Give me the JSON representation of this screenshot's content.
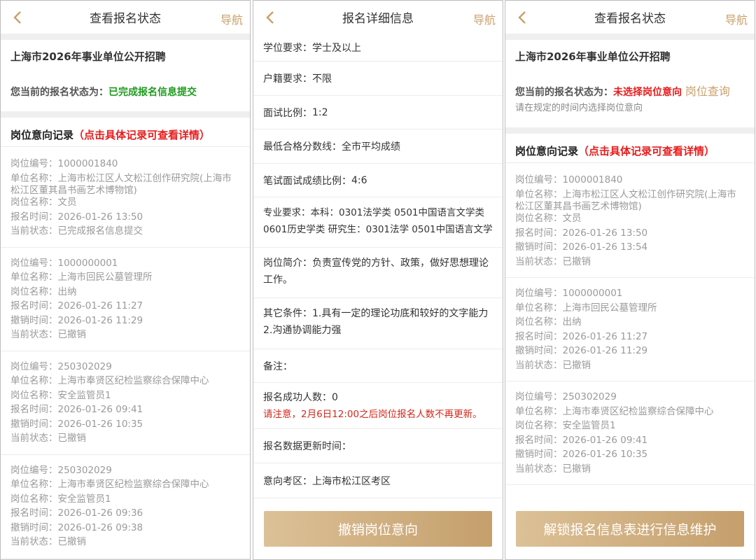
{
  "panel1": {
    "header": {
      "title": "查看报名状态",
      "nav": "导航"
    },
    "project_name": "上海市2026年事业单位公开招聘",
    "status_label": "您当前的报名状态为：",
    "status_value": "已完成报名信息提交",
    "records_title": "岗位意向记录",
    "records_hint": "（点击具体记录可查看详情）",
    "records": [
      {
        "lines": [
          "岗位编号：1000001840",
          "单位名称：上海市松江区人文松江创作研究院(上海市",
          "松江区董其昌书画艺术博物馆)",
          "岗位名称：文员",
          "报名时间：2026-01-26 13:50",
          "当前状态：已完成报名信息提交"
        ]
      },
      {
        "lines": [
          "岗位编号：1000000001",
          "单位名称：上海市回民公墓管理所",
          "岗位名称：出纳",
          "报名时间：2026-01-26 11:27",
          "撤销时间：2026-01-26 11:29",
          "当前状态：已撤销"
        ]
      },
      {
        "lines": [
          "岗位编号：250302029",
          "单位名称：上海市奉贤区纪检监察综合保障中心",
          "岗位名称：安全监管员1",
          "报名时间：2026-01-26 09:41",
          "撤销时间：2026-01-26 10:35",
          "当前状态：已撤销"
        ]
      },
      {
        "lines": [
          "岗位编号：250302029",
          "单位名称：上海市奉贤区纪检监察综合保障中心",
          "岗位名称：安全监管员1",
          "报名时间：2026-01-26 09:36",
          "撤销时间：2026-01-26 09:38",
          "当前状态：已撤销"
        ]
      }
    ]
  },
  "panel2": {
    "header": {
      "title": "报名详细信息",
      "nav": "导航"
    },
    "rows": [
      {
        "label": "学位要求：",
        "value": "学士及以上"
      },
      {
        "label": "户籍要求：",
        "value": "不限"
      },
      {
        "label": "面试比例：",
        "value": "1:2"
      },
      {
        "label": "最低合格分数线：",
        "value": "全市平均成绩"
      },
      {
        "label": "笔试面试成绩比例：",
        "value": "4:6"
      }
    ],
    "major_line1": "专业要求：本科：0301法学类 0501中国语言文学类",
    "major_line2": "0601历史学类 研究生：0301法学 0501中国语言文学",
    "intro_line1": "岗位简介：负责宣传党的方针、政策，做好思想理论",
    "intro_line2": "工作。",
    "other_line1": "其它条件：1.具有一定的理论功底和较好的文字能力",
    "other_line2": "2.沟通协调能力强",
    "remark": "备注：",
    "success_count": "报名成功人数：0",
    "notice": "请注意，2月6日12:00之后岗位报名人数不再更新。",
    "update_time": "报名数据更新时间：",
    "exam_area": "意向考区：上海市松江区考区",
    "button": "撤销岗位意向"
  },
  "panel3": {
    "header": {
      "title": "查看报名状态",
      "nav": "导航"
    },
    "project_name": "上海市2026年事业单位公开招聘",
    "status_label": "您当前的报名状态为：",
    "status_value": "未选择岗位意向",
    "query_link": "岗位查询",
    "sub_hint": "请在规定的时间内选择岗位意向",
    "records_title": "岗位意向记录",
    "records_hint": "（点击具体记录可查看详情）",
    "records": [
      {
        "lines": [
          "岗位编号：1000001840",
          "单位名称：上海市松江区人文松江创作研究院(上海市",
          "松江区董其昌书画艺术博物馆)",
          "岗位名称：文员",
          "报名时间：2026-01-26 13:50",
          "撤销时间：2026-01-26 13:54",
          "当前状态：已撤销"
        ]
      },
      {
        "lines": [
          "岗位编号：1000000001",
          "单位名称：上海市回民公墓管理所",
          "岗位名称：出纳",
          "报名时间：2026-01-26 11:27",
          "撤销时间：2026-01-26 11:29",
          "当前状态：已撤销"
        ]
      },
      {
        "lines": [
          "岗位编号：250302029",
          "单位名称：上海市奉贤区纪检监察综合保障中心",
          "岗位名称：安全监管员1",
          "报名时间：2026-01-26 09:41",
          "撤销时间：2026-01-26 10:35",
          "当前状态：已撤销"
        ]
      }
    ],
    "button": "解锁报名信息表进行信息维护"
  },
  "colors": {
    "accent": "#c9a06c",
    "success": "#1f9a1f",
    "warning": "#e81c1c",
    "separator": "#efefef"
  },
  "icons": {
    "back": "chevron-left-icon"
  }
}
